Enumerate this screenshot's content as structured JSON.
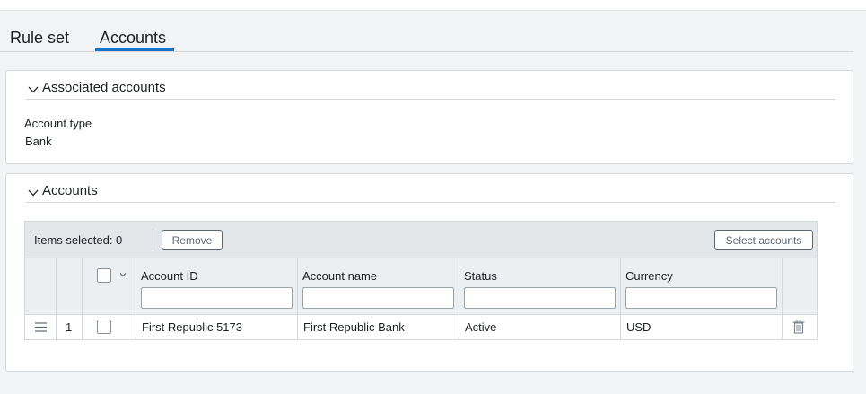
{
  "tabs": [
    {
      "label": "Rule set",
      "active": false
    },
    {
      "label": "Accounts",
      "active": true
    }
  ],
  "colors": {
    "accent": "#1a73c4",
    "panel_bg": "#ffffff",
    "page_bg": "#f2f3f4",
    "toolbar_bg": "#e3e7ea"
  },
  "associated": {
    "title": "Associated accounts",
    "field_label": "Account type",
    "field_value": "Bank"
  },
  "accounts": {
    "title": "Accounts",
    "items_selected": "Items selected: 0",
    "remove_label": "Remove",
    "select_accounts_label": "Select accounts",
    "columns": [
      "Account ID",
      "Account name",
      "Status",
      "Currency"
    ],
    "filters": [
      "",
      "",
      "",
      ""
    ],
    "rows": [
      {
        "num": "1",
        "account_id": "First Republic 5173",
        "account_name": "First Republic Bank",
        "status": "Active",
        "currency": "USD"
      }
    ]
  },
  "icons": {
    "collapse": "chevron-down-icon",
    "drag": "drag-handle-icon",
    "delete": "trash-icon"
  }
}
